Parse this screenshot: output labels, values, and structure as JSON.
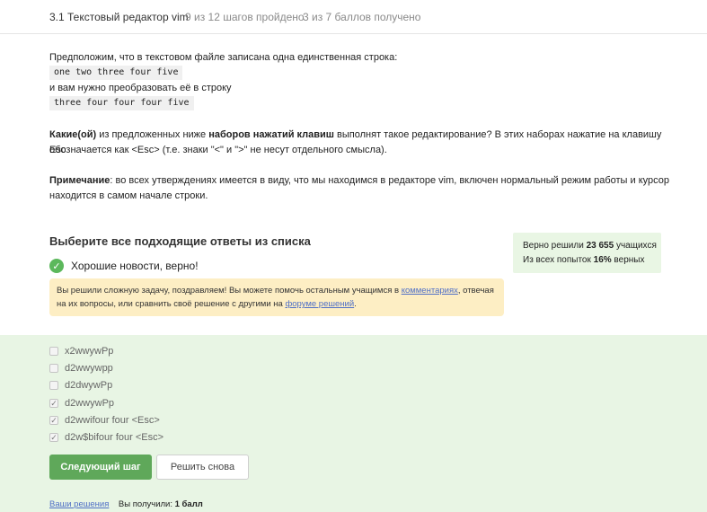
{
  "header": {
    "title": "3.1 Текстовый редактор vim",
    "steps": "9 из 12 шагов пройдено",
    "points": "3 из 7 баллов  получено"
  },
  "task": {
    "intro": "Предположим, что в текстовом файле записана одна единственная строка:",
    "source_line": "one two three four five",
    "middle": "и вам нужно преобразовать её в строку",
    "target_line": "three four four four five",
    "q_bold": "Какие(ой)",
    "q_part1": " из предложенных ниже ",
    "q_bold2": "наборов нажатий клавиш",
    "q_part2": " выполнят такое редактирование? В этих наборах нажатие на клавишу Esc",
    "q_line2": "обозначается как <Esc> (т.е. знаки \"<\" и \">\" не несут отдельного смысла).",
    "note_bold": "Примечание",
    "note_part1": ": во всех утверждениях имеется в виду, что мы находимся в редакторе vim, включен нормальный режим работы и курсор",
    "note_line2": "находится в самом начале строки."
  },
  "choose_title": "Выберите все подходящие ответы из списка",
  "stats": {
    "solved_prefix": "Верно решили ",
    "solved_count": "23 655",
    "solved_suffix": " учащихся",
    "attempts_prefix": "Из всех попыток ",
    "attempts_pct": "16%",
    "attempts_suffix": " верных"
  },
  "result": {
    "good_news": "Хорошие новости, верно!",
    "notice_part1": "Вы решили сложную задачу, поздравляем! Вы можете помочь остальным учащимся в ",
    "notice_link1": "комментариях",
    "notice_part2": ", отвечая",
    "notice_part3": "на их вопросы, или сравнить своё решение с другими на ",
    "notice_link2": "форуме решений",
    "notice_part4": "."
  },
  "options": [
    {
      "label": "x2wwywPp",
      "checked": false
    },
    {
      "label": "d2wwywpp",
      "checked": false
    },
    {
      "label": "d2dwywPp",
      "checked": false
    },
    {
      "label": "d2wwywPp",
      "checked": true
    },
    {
      "label": "d2wwifour four <Esc>",
      "checked": true
    },
    {
      "label": "d2w$bifour four <Esc>",
      "checked": true
    }
  ],
  "buttons": {
    "next": "Следующий шаг",
    "retry": "Решить снова"
  },
  "footer": {
    "solutions_link": "Ваши решения",
    "received_prefix": "Вы получили: ",
    "received_value": "1 балл"
  }
}
